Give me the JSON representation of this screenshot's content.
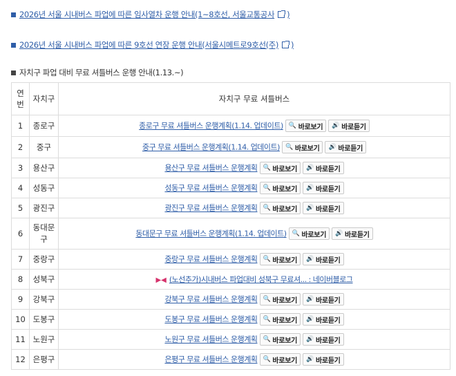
{
  "links": {
    "top1": "2026년 서울 시내버스 파업에 따른 임사열차 운행 안내(1~8호선, 서울교통공사",
    "top2": "2026년 서울 시내버스 파업에 따른 9호선 연장 운행 안내(서울시메트로9호선(주)",
    "close_paren": ")"
  },
  "section_title": "자치구 파업 대비 무료 셔틀버스 운행 안내(1.13.~)",
  "table": {
    "headers": {
      "num": "연번",
      "district": "자치구",
      "shuttle": "자치구 무료 셔틀버스"
    },
    "view_label": "바로보기",
    "listen_label": "바로듣기",
    "rows": [
      {
        "num": "1",
        "district": "종로구",
        "link": "종로구 무료 셔틀버스 운행계획(1.14. 업데이트)"
      },
      {
        "num": "2",
        "district": "중구",
        "link": "중구 무료 셔틀버스 운행계획(1.14. 업데이트)"
      },
      {
        "num": "3",
        "district": "용산구",
        "link": "용산구 무료 셔틀버스 운행계획"
      },
      {
        "num": "4",
        "district": "성동구",
        "link": "성동구 무료 셔틀버스 운행계획"
      },
      {
        "num": "5",
        "district": "광진구",
        "link": "광진구 무료 셔틀버스 운행계획"
      },
      {
        "num": "6",
        "district": "동대문구",
        "link": "동대문구 무료 셔틀버스 운행계획(1.14. 업데이트)"
      },
      {
        "num": "7",
        "district": "중랑구",
        "link": "중랑구 무료 셔틀버스 운행계획"
      },
      {
        "num": "8",
        "district": "성북구",
        "link": "(노선추가)시내버스 파업대비 성북구 무료셔... : 네이버블로그"
      },
      {
        "num": "9",
        "district": "강북구",
        "link": "강북구 무료 셔틀버스 운행계획"
      },
      {
        "num": "10",
        "district": "도봉구",
        "link": "도봉구 무료 셔틀버스 운행계획"
      },
      {
        "num": "11",
        "district": "노원구",
        "link": "노원구 무료 셔틀버스 운행계획"
      },
      {
        "num": "12",
        "district": "은평구",
        "link": "은평구 무료 셔틀버스 운행계획"
      }
    ]
  }
}
